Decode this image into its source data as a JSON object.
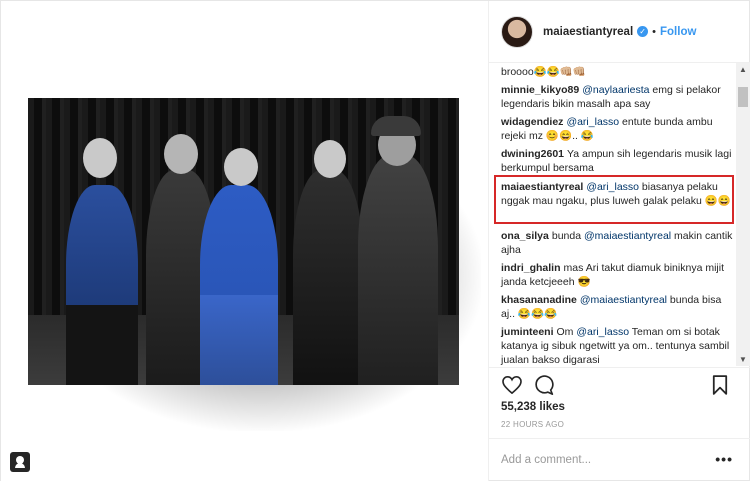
{
  "post": {
    "username": "maiaestiantyreal",
    "dot": "•",
    "follow_label": "Follow",
    "likes": "55,238 likes",
    "time": "22 HOURS AGO",
    "add_comment_placeholder": "Add a comment...",
    "more_label": "•••"
  },
  "comments": [
    {
      "author": "",
      "text": "broooo😂😂👊🏼👊🏼",
      "mention": ""
    },
    {
      "author": "minnie_kikyo89",
      "mention": "@naylaariesta",
      "text": "emg si pelakor legendaris bikin masalh apa say"
    },
    {
      "author": "widagendiez",
      "mention": "@ari_lasso",
      "text": "entute bunda ambu rejeki mz 😊😄.. 😂"
    },
    {
      "author": "dwining2601",
      "mention": "",
      "text": "Ya ampun sih legendaris musik lagi berkumpul bersama"
    },
    {
      "author": "maiaestiantyreal",
      "mention": "@ari_lasso",
      "text": "biasanya pelaku nggak mau ngaku, plus luweh galak pelaku 😄😄"
    },
    {
      "author": "ona_silya",
      "mention": "@maiaestiantyreal",
      "text": "bunda makin cantik ajha",
      "mention_first": false
    },
    {
      "author": "indri_ghalin",
      "mention": "",
      "text": "mas Ari takut diamuk biniknya mijit janda ketcjeeeh 😎"
    },
    {
      "author": "khasananadine",
      "mention": "@maiaestiantyreal",
      "text": "bunda bisa aj.. 😂😂😂"
    },
    {
      "author": "juminteeni",
      "mention": "@ari_lasso",
      "text": "Teman om si botak katanya ig sibuk ngetwitt ya om.. tentunya sambil jualan bakso digarasi",
      "prefix": "Om"
    }
  ],
  "icons": {
    "like": "heart-icon",
    "comment": "comment-icon",
    "save": "bookmark-icon",
    "tag": "user-tag-icon",
    "verified": "verified-badge-icon"
  },
  "colors": {
    "link": "#3897f0",
    "highlight_border": "#d62828",
    "mention": "#003569"
  }
}
